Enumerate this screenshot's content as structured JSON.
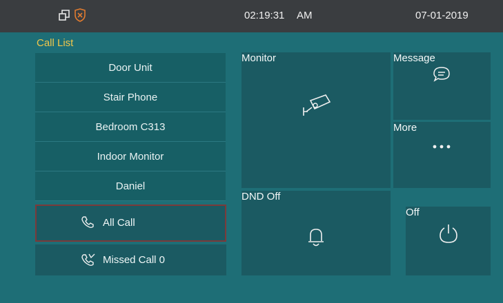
{
  "status_bar": {
    "time": "02:19:31",
    "ampm": "AM",
    "date": "07-01-2019",
    "icons": [
      "window-restore-icon",
      "shield-warning-icon"
    ]
  },
  "call_list": {
    "title": "Call List",
    "items": [
      "Door Unit",
      "Stair Phone",
      "Bedroom C313",
      "Indoor Monitor",
      "Daniel"
    ],
    "all_call_label": "All Call",
    "missed_call_label": "Missed Call 0"
  },
  "tiles": {
    "monitor_label": "Monitor",
    "message_label": "Message",
    "more_label": "More",
    "dnd_label": "DND Off",
    "off_label": "Off"
  },
  "colors": {
    "background": "#1e6e76",
    "topbar": "#3a3d40",
    "tile": "#1b5a62",
    "accent": "#f0c64b",
    "selected_border": "#7b3a3a"
  }
}
